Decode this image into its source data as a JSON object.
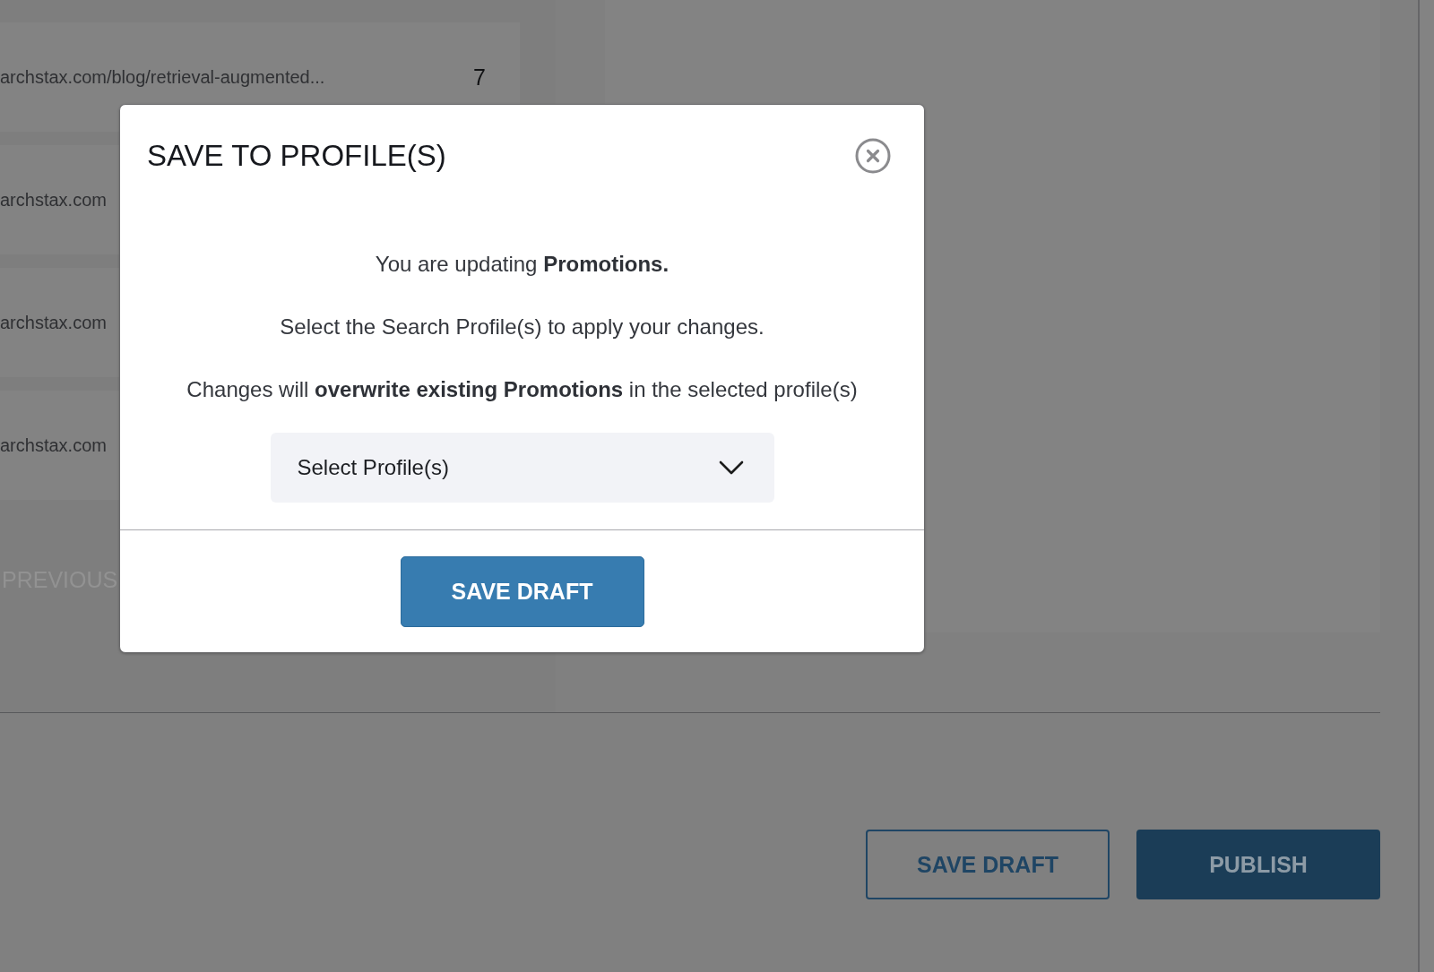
{
  "page": {
    "table": {
      "rows": [
        {
          "url": "archstax.com/blog/retrieval-augmented...",
          "count": "7"
        },
        {
          "url": "archstax.com"
        },
        {
          "url": "archstax.com"
        },
        {
          "url": "archstax.com"
        }
      ]
    },
    "pagination": {
      "label": "PREVIOUS",
      "disabled": true
    }
  },
  "dialog": {
    "title": "SAVE TO PROFILE(S)",
    "messages": [
      "You are updating **Promotions.**",
      "Select the Search Profile(s) to apply your changes.",
      "Changes will **overwrite existing Promotions** in the selected profile(s)"
    ],
    "select": {
      "placeholder": "Select Profile(s)"
    },
    "primary_button": "SAVE DRAFT"
  },
  "actions": [
    {
      "label": "SAVE DRAFT",
      "kind": "outline"
    },
    {
      "label": "PUBLISH",
      "kind": "filled"
    }
  ]
}
